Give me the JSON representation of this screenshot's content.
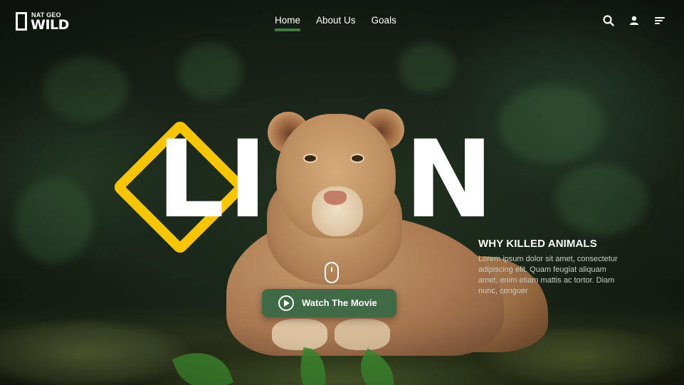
{
  "brand": {
    "top": "NAT GEO",
    "bottom": "WILD"
  },
  "nav": {
    "items": [
      "Home",
      "About Us",
      "Goals"
    ],
    "active": "Home"
  },
  "header_icons": [
    "search-icon",
    "user-icon",
    "menu-icon"
  ],
  "hero": {
    "letters": [
      "L",
      "I",
      "N"
    ],
    "section_title": "WHY KILLED ANIMALS",
    "section_text": "Lorem ipsum dolor sit amet, consectetur adipiscing elit. Quam feugiat aliquam amet, enim etiam mattis ac tortor. Diam nunc, conguer",
    "cta_label": "Watch The Movie"
  },
  "colors": {
    "accent_yellow": "#f7c600",
    "button_green": "#3f6a45",
    "nav_underline": "#3f7a45",
    "text": "#ffffff"
  }
}
